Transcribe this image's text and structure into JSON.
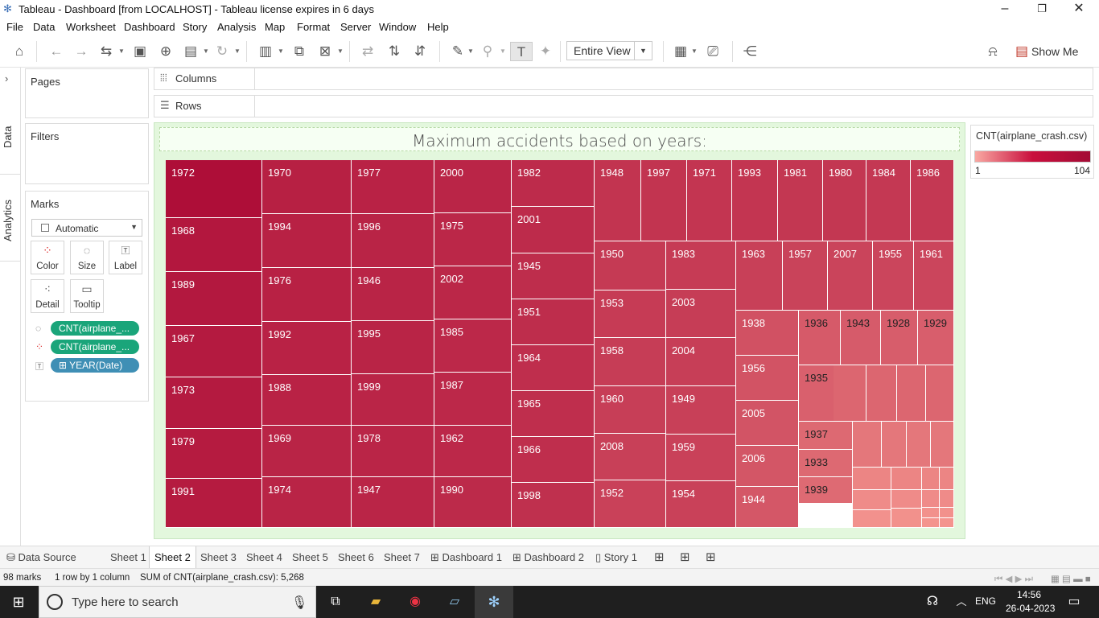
{
  "window": {
    "title": "Tableau - Dashboard [from LOCALHOST] - Tableau license expires in 6 days"
  },
  "menu": [
    "File",
    "Data",
    "Worksheet",
    "Dashboard",
    "Story",
    "Analysis",
    "Map",
    "Format",
    "Server",
    "Window",
    "Help"
  ],
  "toolbar": {
    "fit_value": "Entire View",
    "show_me": "Show Me"
  },
  "side": {
    "data_tab": "Data",
    "analytics_tab": "Analytics"
  },
  "cards": {
    "pages": "Pages",
    "filters": "Filters",
    "marks": "Marks",
    "mark_type": "Automatic",
    "buttons": {
      "color": "Color",
      "size": "Size",
      "label": "Label",
      "detail": "Detail",
      "tooltip": "Tooltip"
    },
    "pills": [
      "CNT(airplane_...",
      "CNT(airplane_...",
      "YEAR(Date)"
    ]
  },
  "shelves": {
    "columns": "Columns",
    "rows": "Rows"
  },
  "dashboard": {
    "title": "Maximum accidents based on years:"
  },
  "legend": {
    "title": "CNT(airplane_crash.csv)",
    "min": "1",
    "max": "104",
    "color_low": "#f9a8a2",
    "color_high": "#a30c35"
  },
  "chart_data": {
    "type": "heatmap",
    "title": "Maximum accidents based on years:",
    "note": "treemap of YEAR(Date) sized and colored by CNT(airplane_crash.csv)",
    "color_range": [
      1,
      104
    ],
    "labeled_years": [
      "1972",
      "1968",
      "1989",
      "1967",
      "1973",
      "1979",
      "1991",
      "1970",
      "1994",
      "1976",
      "1992",
      "1988",
      "1969",
      "1974",
      "1977",
      "1996",
      "1946",
      "1995",
      "1999",
      "1978",
      "1947",
      "2000",
      "1975",
      "2002",
      "1985",
      "1987",
      "1962",
      "1990",
      "1982",
      "2001",
      "1945",
      "1951",
      "1964",
      "1965",
      "1966",
      "1998",
      "1948",
      "1997",
      "1971",
      "1993",
      "1981",
      "1980",
      "1984",
      "1986",
      "1950",
      "1983",
      "1963",
      "1957",
      "2007",
      "1955",
      "1961",
      "1953",
      "2003",
      "1958",
      "2004",
      "1960",
      "1949",
      "2008",
      "1959",
      "1952",
      "1954",
      "1938",
      "1936",
      "1943",
      "1928",
      "1929",
      "1956",
      "1935",
      "2005",
      "1937",
      "2006",
      "1933",
      "1939",
      "1944"
    ],
    "total_marks": 98
  },
  "tabs": {
    "data_source": "Data Source",
    "sheets": [
      "Sheet 1",
      "Sheet 2",
      "Sheet 3",
      "Sheet 4",
      "Sheet 5",
      "Sheet 6",
      "Sheet 7"
    ],
    "dashboards": [
      "Dashboard 1",
      "Dashboard 2"
    ],
    "story": "Story 1",
    "active": "Sheet 2"
  },
  "status": {
    "marks": "98 marks",
    "dims": "1 row by 1 column",
    "sum": "SUM of CNT(airplane_crash.csv): 5,268"
  },
  "taskbar": {
    "search_placeholder": "Type here to search",
    "lang": "ENG",
    "time": "14:56",
    "date": "26-04-2023"
  }
}
